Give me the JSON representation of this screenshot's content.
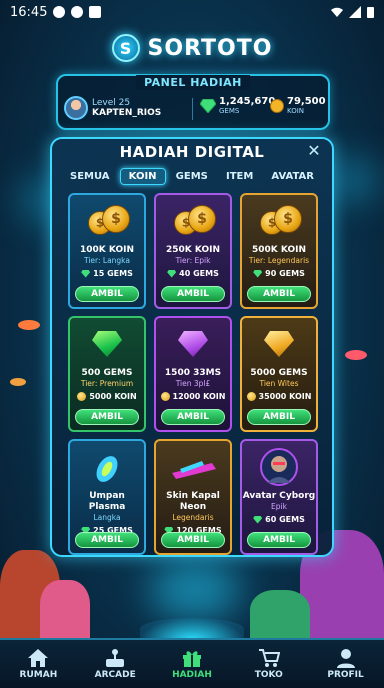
{
  "status_bar": {
    "time": "16:45"
  },
  "app": {
    "logo_letter": "S",
    "name": "SORTOTO"
  },
  "panel": {
    "title": "PANEL HADIAH",
    "level": "Level 25",
    "username": "KAPTEN_RIOS",
    "gems_value": "1,245,670",
    "gems_label": "GEMS",
    "coin_value": "79,500",
    "coin_label": "KOIN"
  },
  "dialog": {
    "title": "HADIAH DIGITAL",
    "close": "✕",
    "tabs": [
      "SEMUA",
      "KOIN",
      "GEMS",
      "ITEM",
      "AVATAR"
    ],
    "active_tab": "KOIN"
  },
  "rewards": [
    {
      "name": "100K KOIN",
      "tier": "Tier: Langka",
      "price": "15 GEMS",
      "price_icon": "gem",
      "art": "coin-stack-icon",
      "button": "AMBIL",
      "style": "c-blue",
      "tier_color": "#7fd8ff"
    },
    {
      "name": "250K KOIN",
      "tier": "Tier: Epik",
      "price": "40 GEMS",
      "price_icon": "gem",
      "art": "coin-stack-icon",
      "button": "AMBIL",
      "style": "c-purple",
      "tier_color": "#d5a6ff"
    },
    {
      "name": "500K KOIN",
      "tier": "Tier: Legendaris",
      "price": "90 GEMS",
      "price_icon": "gem",
      "art": "coin-stack-icon",
      "button": "AMBIL",
      "style": "c-gold",
      "tier_color": "#ffc95a"
    },
    {
      "name": "500 GEMS",
      "tier": "Tier: Premium",
      "price": "5000 KOIN",
      "price_icon": "coin",
      "art": "green-gem-icon",
      "button": "AMBIL",
      "style": "c-green",
      "tier_color": "#ffd36a"
    },
    {
      "name": "1500 33MS",
      "tier": "Tien 3pl£",
      "price": "12000 KOIN",
      "price_icon": "coin",
      "art": "purple-gem-icon",
      "button": "AMBIL",
      "style": "c-violet",
      "tier_color": "#d5a6ff"
    },
    {
      "name": "5000 GEMS",
      "tier": "Tien Wites",
      "price": "35000 KOIN",
      "price_icon": "coin",
      "art": "gold-gem-icon",
      "button": "AMBIL",
      "style": "c-amber",
      "tier_color": "#ffc95a"
    },
    {
      "name": "Umpan Plasma",
      "tier": "Langka",
      "price": "25 GEMS",
      "price_icon": "gem",
      "art": "plasma-bait-icon",
      "button": "AMBIL",
      "style": "c-blue",
      "tier_color": "#7fd8ff"
    },
    {
      "name": "Skin Kapal Neon",
      "tier": "Legendaris",
      "price": "120 GEMS",
      "price_icon": "gem",
      "art": "neon-ship-icon",
      "button": "AMBIL",
      "style": "c-gold",
      "tier_color": "#ffc95a"
    },
    {
      "name": "Avatar Cyborg",
      "tier": "Epik",
      "price": "60 GEMS",
      "price_icon": "gem",
      "art": "cyborg-avatar-icon",
      "button": "AMBIL",
      "style": "c-purple",
      "tier_color": "#d5a6ff"
    }
  ],
  "nav": [
    {
      "label": "RUMAH",
      "icon": "home-icon"
    },
    {
      "label": "ARCADE",
      "icon": "arcade-icon"
    },
    {
      "label": "HADIAH",
      "icon": "gift-icon",
      "active": true
    },
    {
      "label": "TOKO",
      "icon": "cart-icon"
    },
    {
      "label": "PROFIL",
      "icon": "person-icon"
    }
  ]
}
